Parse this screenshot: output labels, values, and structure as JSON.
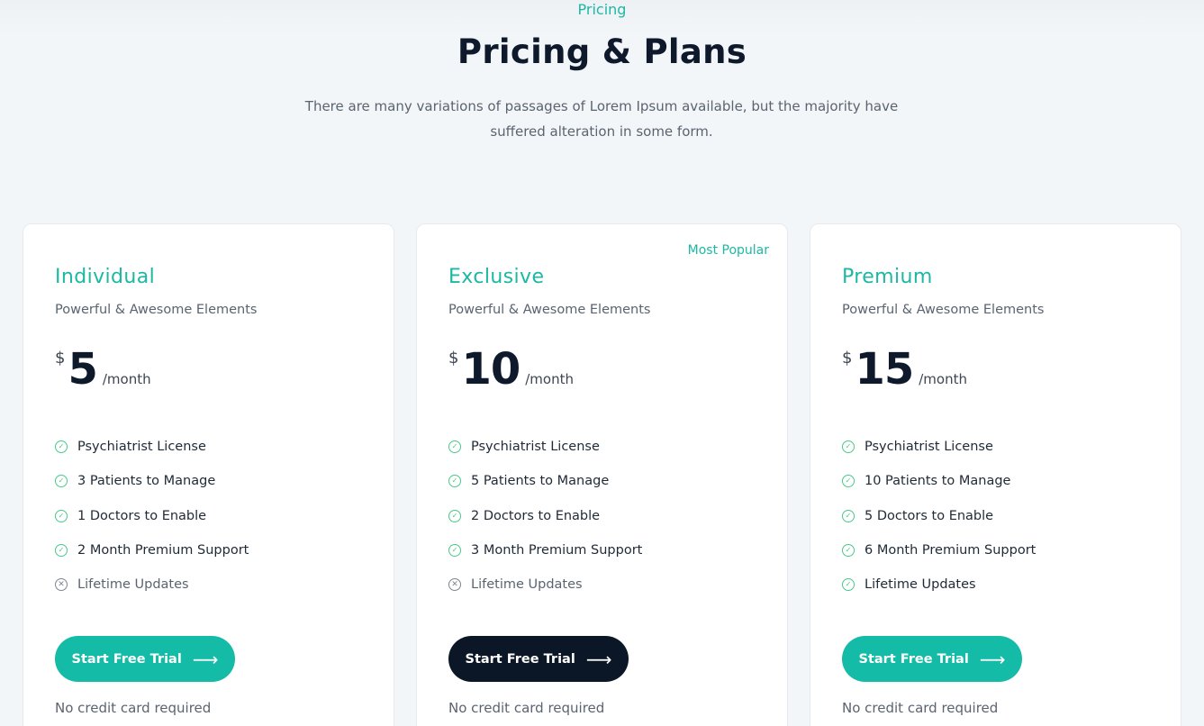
{
  "header": {
    "eyebrow": "Pricing",
    "title": "Pricing & Plans",
    "subtitle_line1": "There are many variations of passages of Lorem Ipsum available, but the majority have",
    "subtitle_line2": "suffered alteration in some form."
  },
  "colors": {
    "accent": "#1db8a4",
    "dark": "#0b1727",
    "check": "#49c989",
    "background": "#f3f6f9"
  },
  "plans": [
    {
      "name": "Individual",
      "description": "Powerful & Awesome Elements",
      "currency": "$",
      "amount": "5",
      "period": "/month",
      "badge": "",
      "features": [
        {
          "icon": "check-circle-icon",
          "text": "Psychiatrist License"
        },
        {
          "icon": "check-circle-icon",
          "text": "3 Patients to Manage"
        },
        {
          "icon": "check-circle-icon",
          "text": "1 Doctors to Enable"
        },
        {
          "icon": "check-circle-icon",
          "text": "2 Month Premium Support"
        },
        {
          "icon": "x-circle-icon",
          "text": "Lifetime Updates"
        }
      ],
      "cta": "Start Free Trial",
      "note": "No credit card required"
    },
    {
      "name": "Exclusive",
      "description": "Powerful & Awesome Elements",
      "currency": "$",
      "amount": "10",
      "period": "/month",
      "badge": "Most Popular",
      "features": [
        {
          "icon": "check-circle-icon",
          "text": "Psychiatrist License"
        },
        {
          "icon": "check-circle-icon",
          "text": "5 Patients to Manage"
        },
        {
          "icon": "check-circle-icon",
          "text": "2 Doctors to Enable"
        },
        {
          "icon": "check-circle-icon",
          "text": "3 Month Premium Support"
        },
        {
          "icon": "x-circle-icon",
          "text": "Lifetime Updates"
        }
      ],
      "cta": "Start Free Trial",
      "note": "No credit card required"
    },
    {
      "name": "Premium",
      "description": "Powerful & Awesome Elements",
      "currency": "$",
      "amount": "15",
      "period": "/month",
      "badge": "",
      "features": [
        {
          "icon": "check-circle-icon",
          "text": "Psychiatrist License"
        },
        {
          "icon": "check-circle-icon",
          "text": "10 Patients to Manage"
        },
        {
          "icon": "check-circle-icon",
          "text": "5 Doctors to Enable"
        },
        {
          "icon": "check-circle-icon",
          "text": "6 Month Premium Support"
        },
        {
          "icon": "check-circle-icon",
          "text": "Lifetime Updates"
        }
      ],
      "cta": "Start Free Trial",
      "note": "No credit card required"
    }
  ]
}
